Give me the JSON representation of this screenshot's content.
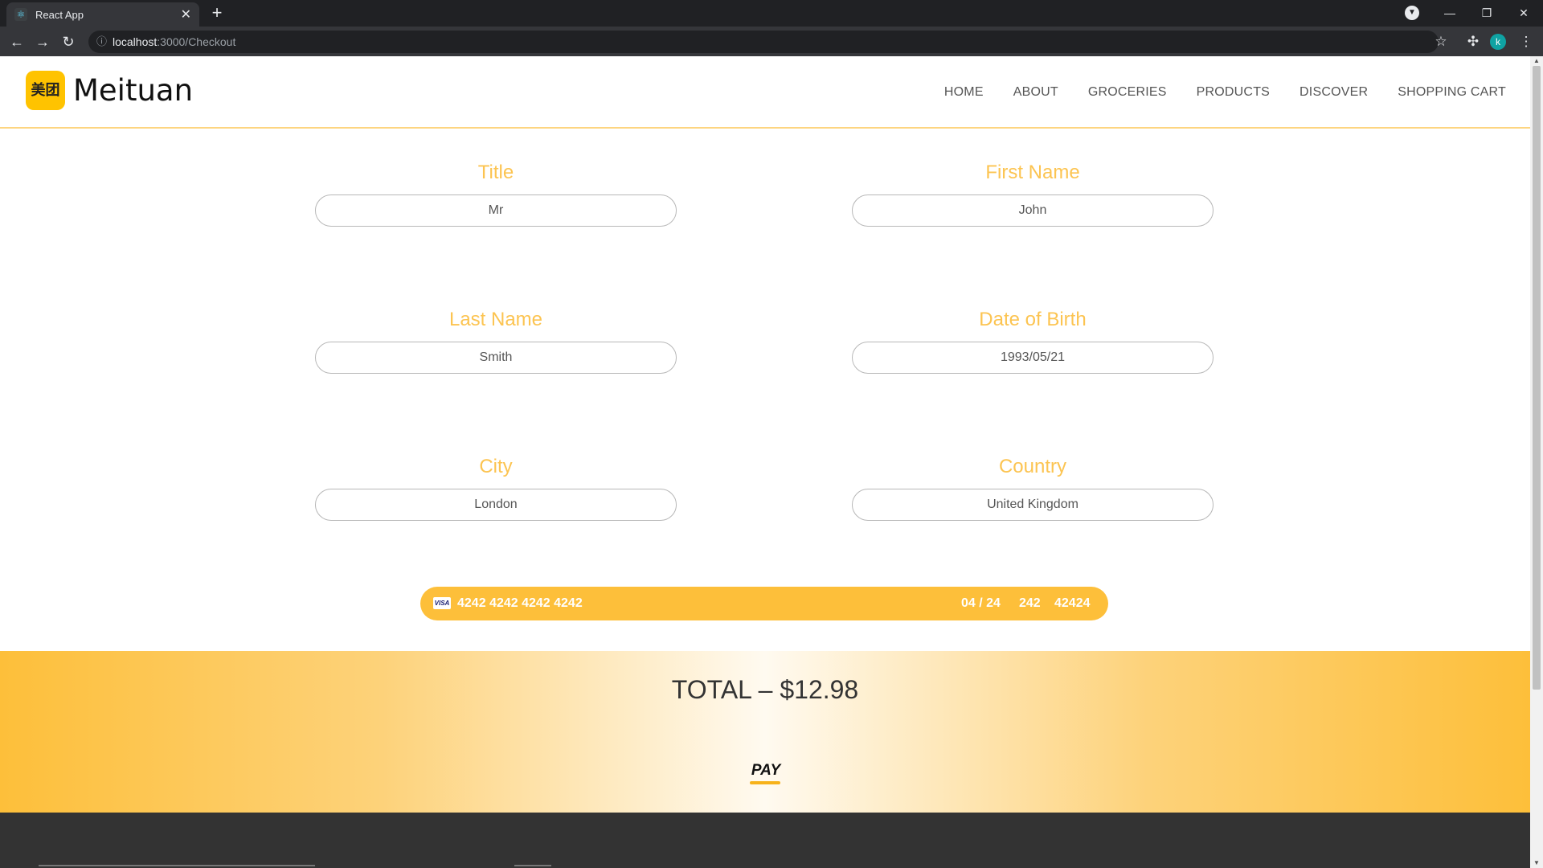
{
  "browser": {
    "tab_title": "React App",
    "tab_close": "✕",
    "new_tab": "+",
    "url_host": "localhost",
    "url_path": ":3000/Checkout",
    "profile_initial": "k",
    "icons": [
      "back-icon",
      "forward-icon",
      "reload-icon",
      "info-icon",
      "star-icon",
      "extensions-icon",
      "menu-icon"
    ]
  },
  "header": {
    "logo_mark": "美团",
    "logo_text": "Meituan",
    "nav": [
      "HOME",
      "ABOUT",
      "GROCERIES",
      "PRODUCTS",
      "DISCOVER",
      "SHOPPING CART"
    ]
  },
  "form": {
    "title": {
      "label": "Title",
      "value": "Mr"
    },
    "first_name": {
      "label": "First Name",
      "value": "John"
    },
    "last_name": {
      "label": "Last Name",
      "value": "Smith"
    },
    "dob": {
      "label": "Date of Birth",
      "value": "1993/05/21"
    },
    "city": {
      "label": "City",
      "value": "London"
    },
    "country": {
      "label": "Country",
      "value": "United Kingdom"
    }
  },
  "card": {
    "brand": "VISA",
    "number": "4242 4242 4242 4242",
    "expiry": "04 / 24",
    "cvc": "242",
    "zip": "42424"
  },
  "checkout": {
    "total": "TOTAL – $12.98",
    "pay_label": "PAY"
  },
  "colors": {
    "accent": "#fdbf3a",
    "label": "#fcc451",
    "footer": "#333333"
  }
}
